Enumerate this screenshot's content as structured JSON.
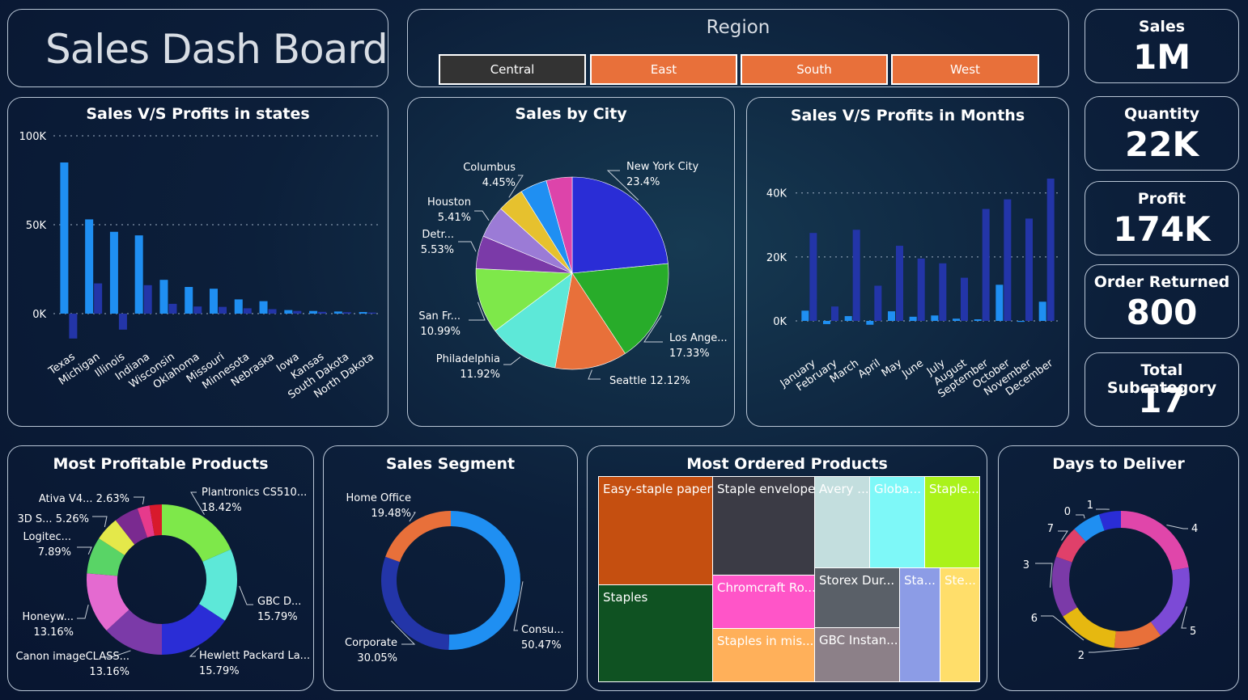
{
  "title": "Sales Dash Board",
  "region": {
    "label": "Region",
    "options": [
      "Central",
      "East",
      "South",
      "West"
    ],
    "selected": "Central",
    "selected_color": "#333333",
    "option_color": "#e8703a"
  },
  "kpis": [
    {
      "label": "Sales",
      "value": "1M"
    },
    {
      "label": "Quantity",
      "value": "22K"
    },
    {
      "label": "Profit",
      "value": "174K"
    },
    {
      "label": "Order Returned",
      "value": "800"
    },
    {
      "label": "Total Subcategory",
      "value": "17"
    }
  ],
  "states_chart": {
    "title": "Sales V/S Profits in states"
  },
  "city_chart": {
    "title": "Sales by City"
  },
  "months_chart": {
    "title": "Sales V/S Profits in Months"
  },
  "profitable_chart": {
    "title": "Most Profitable Products"
  },
  "segment_chart": {
    "title": "Sales Segment"
  },
  "ordered_chart": {
    "title": "Most Ordered Products"
  },
  "deliver_chart": {
    "title": "Days to Deliver"
  },
  "chart_data": [
    {
      "id": "states",
      "type": "bar",
      "categories": [
        "Texas",
        "Michigan",
        "Illinois",
        "Indiana",
        "Wisconsin",
        "Oklahoma",
        "Missouri",
        "Minnesota",
        "Nebraska",
        "Iowa",
        "Kansas",
        "South Dakota",
        "North Dakota"
      ],
      "series": [
        {
          "values": [
            85000,
            53000,
            46000,
            44000,
            19000,
            15000,
            14000,
            8000,
            7000,
            2000,
            1500,
            1200,
            900
          ],
          "color": "#1f8ff2"
        },
        {
          "values": [
            -14000,
            17000,
            -9000,
            16000,
            5500,
            4000,
            3800,
            3000,
            2500,
            1500,
            1000,
            800,
            600
          ],
          "color": "#2335a8"
        }
      ],
      "yticks": [
        "100K",
        "50K",
        "0K"
      ],
      "ylim": [
        -20000,
        100000
      ]
    },
    {
      "id": "city",
      "type": "pie",
      "slices": [
        {
          "label": "New York City",
          "pct": "23.4%",
          "value": 23.4,
          "color": "#2a2dd6"
        },
        {
          "label": "Los Ange...",
          "pct": "17.33%",
          "value": 17.33,
          "color": "#28ac2a"
        },
        {
          "label": "Seattle",
          "pct": "12.12%",
          "value": 12.12,
          "color": "#e8703a"
        },
        {
          "label": "Philadelphia",
          "pct": "11.92%",
          "value": 11.92,
          "color": "#5de8d8"
        },
        {
          "label": "San Fr...",
          "pct": "10.99%",
          "value": 10.99,
          "color": "#7ee84a"
        },
        {
          "label": "Detr...",
          "pct": "5.53%",
          "value": 5.53,
          "color": "#7b3aa8"
        },
        {
          "label": "Houston",
          "pct": "5.41%",
          "value": 5.41,
          "color": "#9b7bd6"
        },
        {
          "label": "Columbus",
          "pct": "4.45%",
          "value": 4.45,
          "color": "#e6c12e"
        },
        {
          "label": "",
          "pct": "",
          "value": 4.5,
          "color": "#1f8ff2"
        },
        {
          "label": "",
          "pct": "",
          "value": 4.35,
          "color": "#dd44aa"
        }
      ]
    },
    {
      "id": "months",
      "type": "bar",
      "categories": [
        "January",
        "February",
        "March",
        "April",
        "May",
        "June",
        "July",
        "August",
        "September",
        "October",
        "November",
        "December"
      ],
      "series": [
        {
          "values": [
            3200,
            -1000,
            1500,
            -1200,
            3000,
            1300,
            1700,
            700,
            500,
            11300,
            -300,
            6000
          ],
          "color": "#1f8ff2"
        },
        {
          "values": [
            27500,
            4500,
            28500,
            11000,
            23500,
            19500,
            18000,
            13500,
            35000,
            38000,
            32000,
            44500
          ],
          "color": "#2335a8"
        }
      ],
      "yticks": [
        "40K",
        "20K",
        "0K"
      ],
      "ylim": [
        -5000,
        46000
      ]
    },
    {
      "id": "profitable",
      "type": "pie",
      "donut": true,
      "slices": [
        {
          "label": "Plantronics CS510...",
          "pct": "18.42%",
          "value": 18.42,
          "color": "#7ee84a"
        },
        {
          "label": "GBC D...",
          "pct": "15.79%",
          "value": 15.79,
          "color": "#5de8d8"
        },
        {
          "label": "Hewlett Packard La...",
          "pct": "15.79%",
          "value": 15.79,
          "color": "#2a2dd6"
        },
        {
          "label": "Canon imageCLASS...",
          "pct": "13.16%",
          "value": 13.16,
          "color": "#7b3aa8"
        },
        {
          "label": "Honeyw...",
          "pct": "13.16%",
          "value": 13.16,
          "color": "#e46ad0"
        },
        {
          "label": "Logitec...",
          "pct": "7.89%",
          "value": 7.89,
          "color": "#59d466"
        },
        {
          "label": "3D S...",
          "pct": "5.26%",
          "value": 5.26,
          "color": "#e4e84a"
        },
        {
          "label": "",
          "pct": "",
          "value": 5.26,
          "color": "#7a2a90"
        },
        {
          "label": "Ativa V4...",
          "pct": "2.63%",
          "value": 2.63,
          "color": "#e63a8c"
        },
        {
          "label": "",
          "pct": "",
          "value": 2.64,
          "color": "#d81a2c"
        }
      ]
    },
    {
      "id": "segment",
      "type": "pie",
      "donut": true,
      "slices": [
        {
          "label": "Consu...",
          "pct": "50.47%",
          "value": 50.47,
          "color": "#1f8ff2"
        },
        {
          "label": "Corporate",
          "pct": "30.05%",
          "value": 30.05,
          "color": "#2335a8"
        },
        {
          "label": "Home Office",
          "pct": "19.48%",
          "value": 19.48,
          "color": "#e8703a"
        }
      ]
    },
    {
      "id": "ordered",
      "type": "treemap",
      "cells": [
        {
          "label": "Easy-staple paper",
          "color": "#c54f10"
        },
        {
          "label": "Staples",
          "color": "#0f5222"
        },
        {
          "label": "Staple envelope",
          "color": "#3b3b45"
        },
        {
          "label": "Chromcraft Ro...",
          "color": "#ff55c8"
        },
        {
          "label": "Staples in mis...",
          "color": "#ffb05a"
        },
        {
          "label": "Avery ...",
          "color": "#c3dede"
        },
        {
          "label": "Globa...",
          "color": "#7ef8f8"
        },
        {
          "label": "Staple...",
          "color": "#aaf21a"
        },
        {
          "label": "Storex Dur...",
          "color": "#5a6068"
        },
        {
          "label": "GBC Instan...",
          "color": "#8c8088"
        },
        {
          "label": "Sta...",
          "color": "#8c9ce6"
        },
        {
          "label": "Ste...",
          "color": "#ffde6a"
        }
      ]
    },
    {
      "id": "deliver",
      "type": "pie",
      "donut": true,
      "slices": [
        {
          "label": "4",
          "value": 21.5,
          "color": "#e046aa"
        },
        {
          "label": "5",
          "value": 17.5,
          "color": "#7c4ad6"
        },
        {
          "label": "2",
          "value": 11,
          "color": "#e8703a"
        },
        {
          "label": "6",
          "value": 14,
          "color": "#e6b810"
        },
        {
          "label": "3",
          "value": 14,
          "color": "#7b3aa8"
        },
        {
          "label": "7",
          "value": 7.5,
          "color": "#e0406a"
        },
        {
          "label": "0",
          "value": 6.5,
          "color": "#1f8ff2"
        },
        {
          "label": "1",
          "value": 5,
          "color": "#2a2dd6"
        }
      ]
    }
  ]
}
